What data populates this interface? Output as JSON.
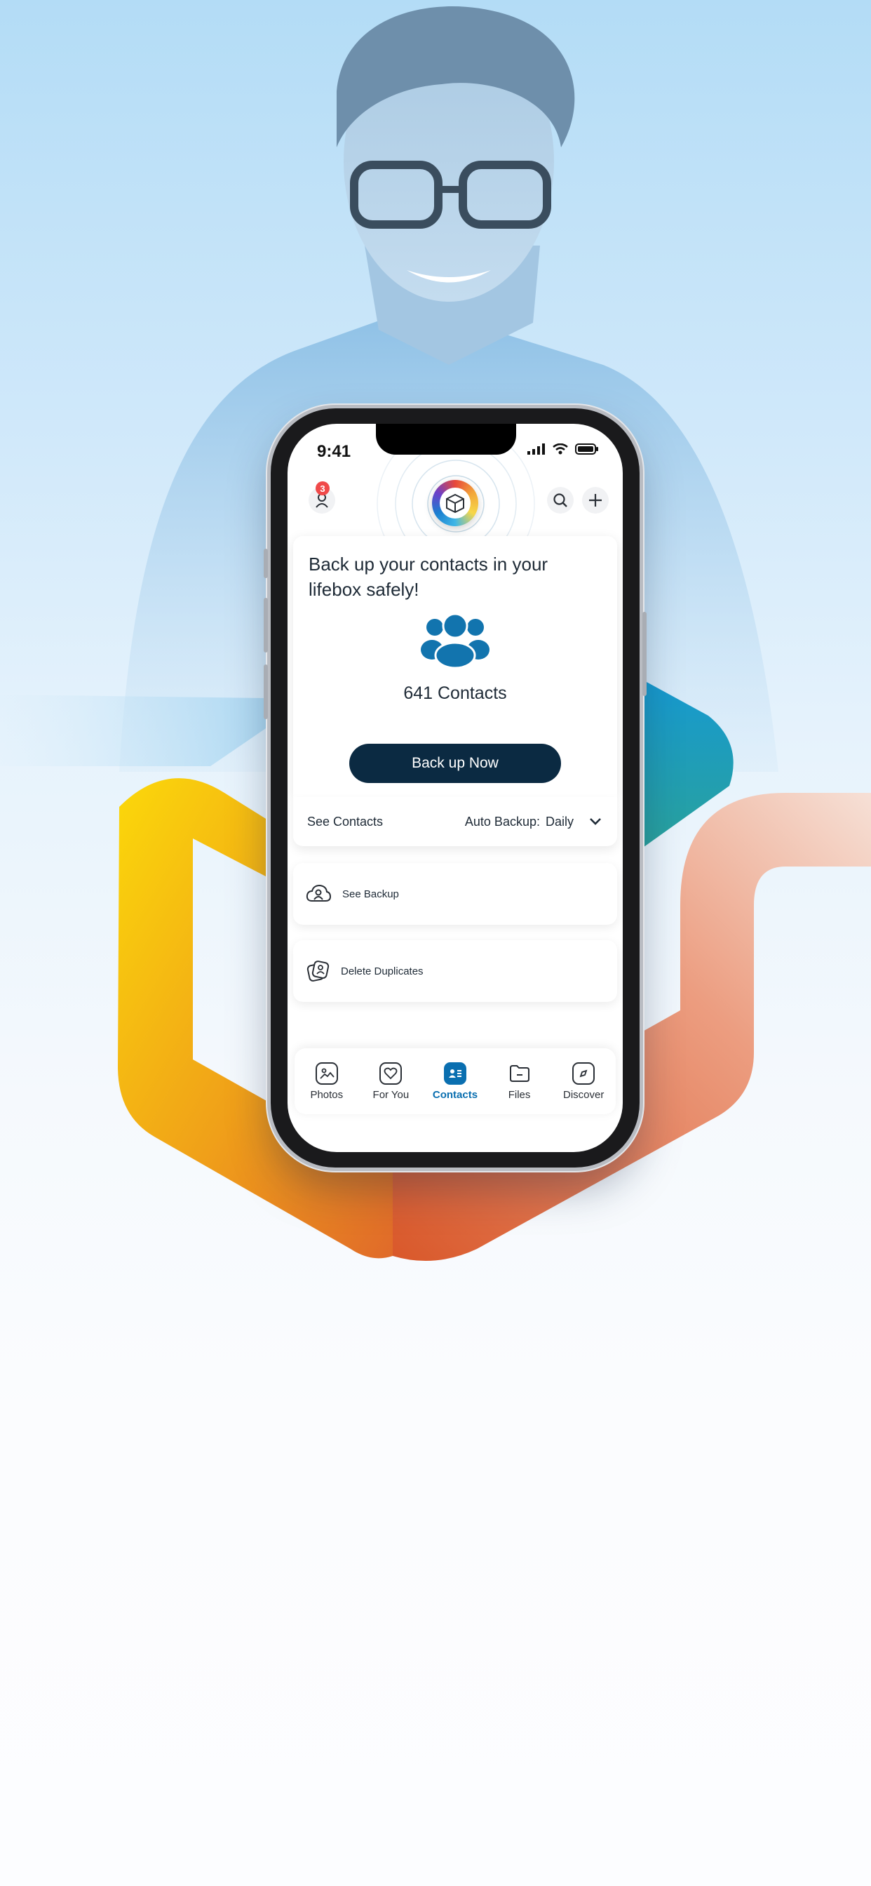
{
  "status_bar": {
    "time": "9:41"
  },
  "header": {
    "notification_count": "3"
  },
  "backup_card": {
    "title": "Back up your contacts in your lifebox safely!",
    "contacts_count": "641 Contacts",
    "button_label": "Back up Now"
  },
  "contacts_bar": {
    "see_contacts": "See Contacts",
    "auto_backup_label": "Auto Backup:",
    "auto_backup_value": "Daily"
  },
  "actions": [
    {
      "label": "See Backup",
      "icon": "cloud-user-icon"
    },
    {
      "label": "Delete Duplicates",
      "icon": "duplicate-contacts-icon"
    }
  ],
  "tabs": [
    {
      "label": "Photos",
      "icon": "photos-icon"
    },
    {
      "label": "For You",
      "icon": "heart-icon"
    },
    {
      "label": "Contacts",
      "icon": "contacts-icon",
      "active": true
    },
    {
      "label": "Files",
      "icon": "folder-icon"
    },
    {
      "label": "Discover",
      "icon": "compass-icon"
    }
  ],
  "colors": {
    "accent": "#0a6fb0",
    "button_dark": "#0b2a42",
    "badge": "#f04a4a"
  }
}
